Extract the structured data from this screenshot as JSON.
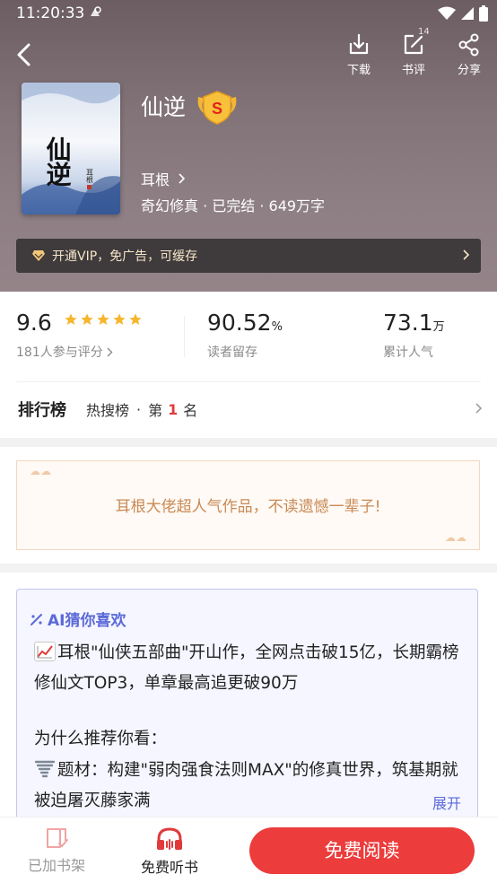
{
  "status_bar": {
    "time": "11:20:33"
  },
  "header": {
    "actions": [
      {
        "label": "下载",
        "icon": "download-icon"
      },
      {
        "label": "书评",
        "icon": "review-icon",
        "badge": "14"
      },
      {
        "label": "分享",
        "icon": "share-icon"
      }
    ],
    "cover": {
      "title_glyphs": "仙逆",
      "author_glyphs": "耳根"
    },
    "book_title": "仙逆",
    "rank_badge": "S",
    "author": "耳根",
    "meta": "奇幻修真 · 已完结 · 649万字",
    "vip_text": "开通VIP，免广告，可缓存"
  },
  "stats": {
    "score": "9.6",
    "score_stars": 5,
    "score_sub": "181人参与评分",
    "retention": "90.52",
    "retention_unit": "%",
    "retention_sub": "读者留存",
    "popularity": "73.1",
    "popularity_unit": "万",
    "popularity_sub": "累计人气"
  },
  "ranking": {
    "title": "排行榜",
    "list_name": "热搜榜",
    "sep": "·",
    "prefix": "第",
    "position": "1",
    "suffix": "名"
  },
  "slogan": "耳根大佬超人气作品，不读遗憾一辈子!",
  "ai": {
    "title": "AI猜你喜欢",
    "para1": "耳根\"仙侠五部曲\"开山作，全网点击破15亿，长期霸榜修仙文TOP3，单章最高追更破90万",
    "para2": "为什么推荐你看：",
    "para3": "题材：构建\"弱肉强食法则MAX\"的修真世界，筑基期就被迫屠灭藤家满",
    "expand": "展开"
  },
  "bottom_bar": {
    "shelf_label": "已加书架",
    "listen_label": "免费听书",
    "read_label": "免费阅读"
  },
  "colors": {
    "accent_red": "#ec3c3c",
    "star": "#f7b52b",
    "ai_accent": "#5b6ad8",
    "slogan": "#c98a55"
  }
}
